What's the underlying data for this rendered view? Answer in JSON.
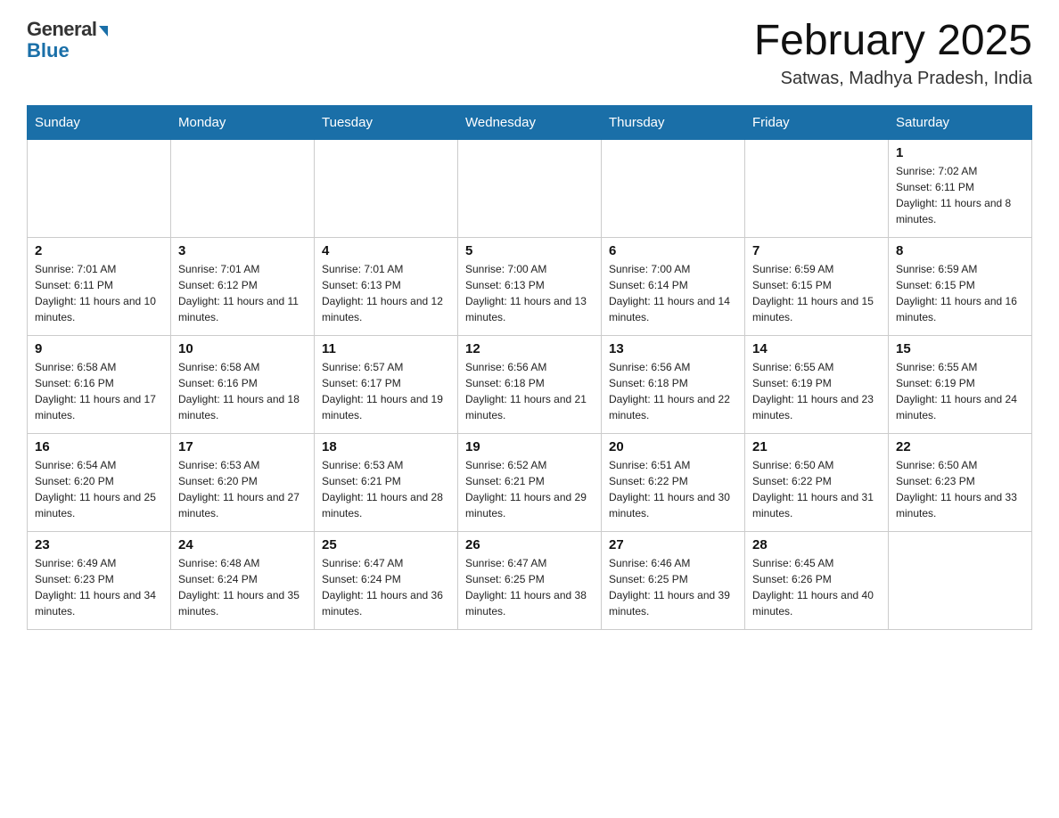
{
  "logo": {
    "general": "General",
    "blue": "Blue"
  },
  "header": {
    "month_year": "February 2025",
    "location": "Satwas, Madhya Pradesh, India"
  },
  "weekdays": [
    "Sunday",
    "Monday",
    "Tuesday",
    "Wednesday",
    "Thursday",
    "Friday",
    "Saturday"
  ],
  "weeks": [
    [
      {
        "day": "",
        "info": ""
      },
      {
        "day": "",
        "info": ""
      },
      {
        "day": "",
        "info": ""
      },
      {
        "day": "",
        "info": ""
      },
      {
        "day": "",
        "info": ""
      },
      {
        "day": "",
        "info": ""
      },
      {
        "day": "1",
        "info": "Sunrise: 7:02 AM\nSunset: 6:11 PM\nDaylight: 11 hours and 8 minutes."
      }
    ],
    [
      {
        "day": "2",
        "info": "Sunrise: 7:01 AM\nSunset: 6:11 PM\nDaylight: 11 hours and 10 minutes."
      },
      {
        "day": "3",
        "info": "Sunrise: 7:01 AM\nSunset: 6:12 PM\nDaylight: 11 hours and 11 minutes."
      },
      {
        "day": "4",
        "info": "Sunrise: 7:01 AM\nSunset: 6:13 PM\nDaylight: 11 hours and 12 minutes."
      },
      {
        "day": "5",
        "info": "Sunrise: 7:00 AM\nSunset: 6:13 PM\nDaylight: 11 hours and 13 minutes."
      },
      {
        "day": "6",
        "info": "Sunrise: 7:00 AM\nSunset: 6:14 PM\nDaylight: 11 hours and 14 minutes."
      },
      {
        "day": "7",
        "info": "Sunrise: 6:59 AM\nSunset: 6:15 PM\nDaylight: 11 hours and 15 minutes."
      },
      {
        "day": "8",
        "info": "Sunrise: 6:59 AM\nSunset: 6:15 PM\nDaylight: 11 hours and 16 minutes."
      }
    ],
    [
      {
        "day": "9",
        "info": "Sunrise: 6:58 AM\nSunset: 6:16 PM\nDaylight: 11 hours and 17 minutes."
      },
      {
        "day": "10",
        "info": "Sunrise: 6:58 AM\nSunset: 6:16 PM\nDaylight: 11 hours and 18 minutes."
      },
      {
        "day": "11",
        "info": "Sunrise: 6:57 AM\nSunset: 6:17 PM\nDaylight: 11 hours and 19 minutes."
      },
      {
        "day": "12",
        "info": "Sunrise: 6:56 AM\nSunset: 6:18 PM\nDaylight: 11 hours and 21 minutes."
      },
      {
        "day": "13",
        "info": "Sunrise: 6:56 AM\nSunset: 6:18 PM\nDaylight: 11 hours and 22 minutes."
      },
      {
        "day": "14",
        "info": "Sunrise: 6:55 AM\nSunset: 6:19 PM\nDaylight: 11 hours and 23 minutes."
      },
      {
        "day": "15",
        "info": "Sunrise: 6:55 AM\nSunset: 6:19 PM\nDaylight: 11 hours and 24 minutes."
      }
    ],
    [
      {
        "day": "16",
        "info": "Sunrise: 6:54 AM\nSunset: 6:20 PM\nDaylight: 11 hours and 25 minutes."
      },
      {
        "day": "17",
        "info": "Sunrise: 6:53 AM\nSunset: 6:20 PM\nDaylight: 11 hours and 27 minutes."
      },
      {
        "day": "18",
        "info": "Sunrise: 6:53 AM\nSunset: 6:21 PM\nDaylight: 11 hours and 28 minutes."
      },
      {
        "day": "19",
        "info": "Sunrise: 6:52 AM\nSunset: 6:21 PM\nDaylight: 11 hours and 29 minutes."
      },
      {
        "day": "20",
        "info": "Sunrise: 6:51 AM\nSunset: 6:22 PM\nDaylight: 11 hours and 30 minutes."
      },
      {
        "day": "21",
        "info": "Sunrise: 6:50 AM\nSunset: 6:22 PM\nDaylight: 11 hours and 31 minutes."
      },
      {
        "day": "22",
        "info": "Sunrise: 6:50 AM\nSunset: 6:23 PM\nDaylight: 11 hours and 33 minutes."
      }
    ],
    [
      {
        "day": "23",
        "info": "Sunrise: 6:49 AM\nSunset: 6:23 PM\nDaylight: 11 hours and 34 minutes."
      },
      {
        "day": "24",
        "info": "Sunrise: 6:48 AM\nSunset: 6:24 PM\nDaylight: 11 hours and 35 minutes."
      },
      {
        "day": "25",
        "info": "Sunrise: 6:47 AM\nSunset: 6:24 PM\nDaylight: 11 hours and 36 minutes."
      },
      {
        "day": "26",
        "info": "Sunrise: 6:47 AM\nSunset: 6:25 PM\nDaylight: 11 hours and 38 minutes."
      },
      {
        "day": "27",
        "info": "Sunrise: 6:46 AM\nSunset: 6:25 PM\nDaylight: 11 hours and 39 minutes."
      },
      {
        "day": "28",
        "info": "Sunrise: 6:45 AM\nSunset: 6:26 PM\nDaylight: 11 hours and 40 minutes."
      },
      {
        "day": "",
        "info": ""
      }
    ]
  ]
}
